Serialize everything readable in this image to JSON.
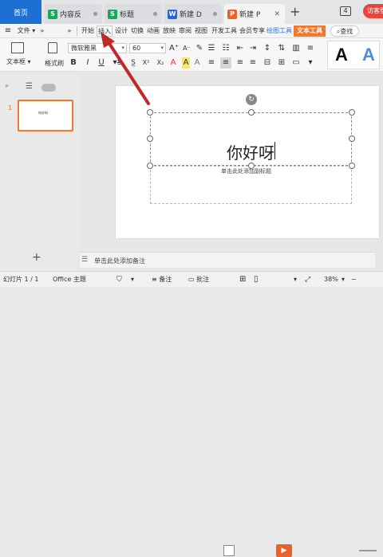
{
  "tabs": {
    "home": "首页",
    "items": [
      {
        "label": "内容反",
        "badge": "S",
        "color": "#18a95c"
      },
      {
        "label": "标题",
        "badge": "S",
        "color": "#18a95c"
      },
      {
        "label": "新建 D",
        "badge": "W",
        "color": "#2b63d4"
      },
      {
        "label": "新建 P",
        "badge": "P",
        "color": "#e8632b"
      }
    ],
    "new_tab": "+",
    "window_count": "4",
    "guest": "访客登"
  },
  "menubar": {
    "hamburger": "≡",
    "file": "文件",
    "items": [
      "开始",
      "插入",
      "设计",
      "切换",
      "动画",
      "放映",
      "审阅",
      "视图",
      "开发工具",
      "会员专享",
      "绘图工具",
      "文本工具"
    ],
    "search": "查找"
  },
  "ribbon": {
    "textbox": "文本框",
    "format_painter": "格式刷",
    "font_name": "微软雅黑",
    "font_size": "60",
    "bold": "B",
    "italic": "I",
    "underline": "U",
    "strike": "S",
    "sup": "X²",
    "sub": "X₂",
    "font_color": "A",
    "highlight": "A",
    "clear": "A",
    "style_black": "A",
    "style_blue": "A"
  },
  "left_panel": {
    "slide_number": "1",
    "slide_thumb_text": "你好呀",
    "add": "+"
  },
  "slide": {
    "title_text": "你好呀",
    "subtitle_placeholder": "单击此处添加副标题"
  },
  "notes_placeholder": "单击此处添加备注",
  "status": {
    "slide_info": "幻灯片 1 / 1",
    "theme": "Office 主题",
    "notes_btn": "备注",
    "comment_btn": "批注",
    "zoom": "38%"
  },
  "colors": {
    "accent_blue": "#1d6fd4",
    "accent_orange": "#f07a2c",
    "arrow_red": "#c0282a"
  }
}
